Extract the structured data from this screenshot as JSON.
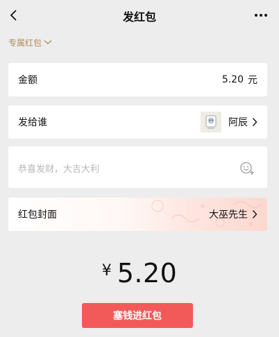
{
  "nav": {
    "title": "发红包"
  },
  "type_selector": {
    "label": "专属红包"
  },
  "amount": {
    "label": "金额",
    "value": "5.20",
    "unit": "元"
  },
  "recipient": {
    "label": "发给谁",
    "name": "阿辰"
  },
  "message": {
    "placeholder": "恭喜发财，大吉大利"
  },
  "cover": {
    "label": "红包封面",
    "name": "大巫先生"
  },
  "total": {
    "currency": "¥",
    "value": "5.20"
  },
  "submit": {
    "label": "塞钱进红包"
  },
  "colors": {
    "accent": "#f25a5a",
    "type_label": "#b08a5a",
    "background": "#ededed"
  }
}
